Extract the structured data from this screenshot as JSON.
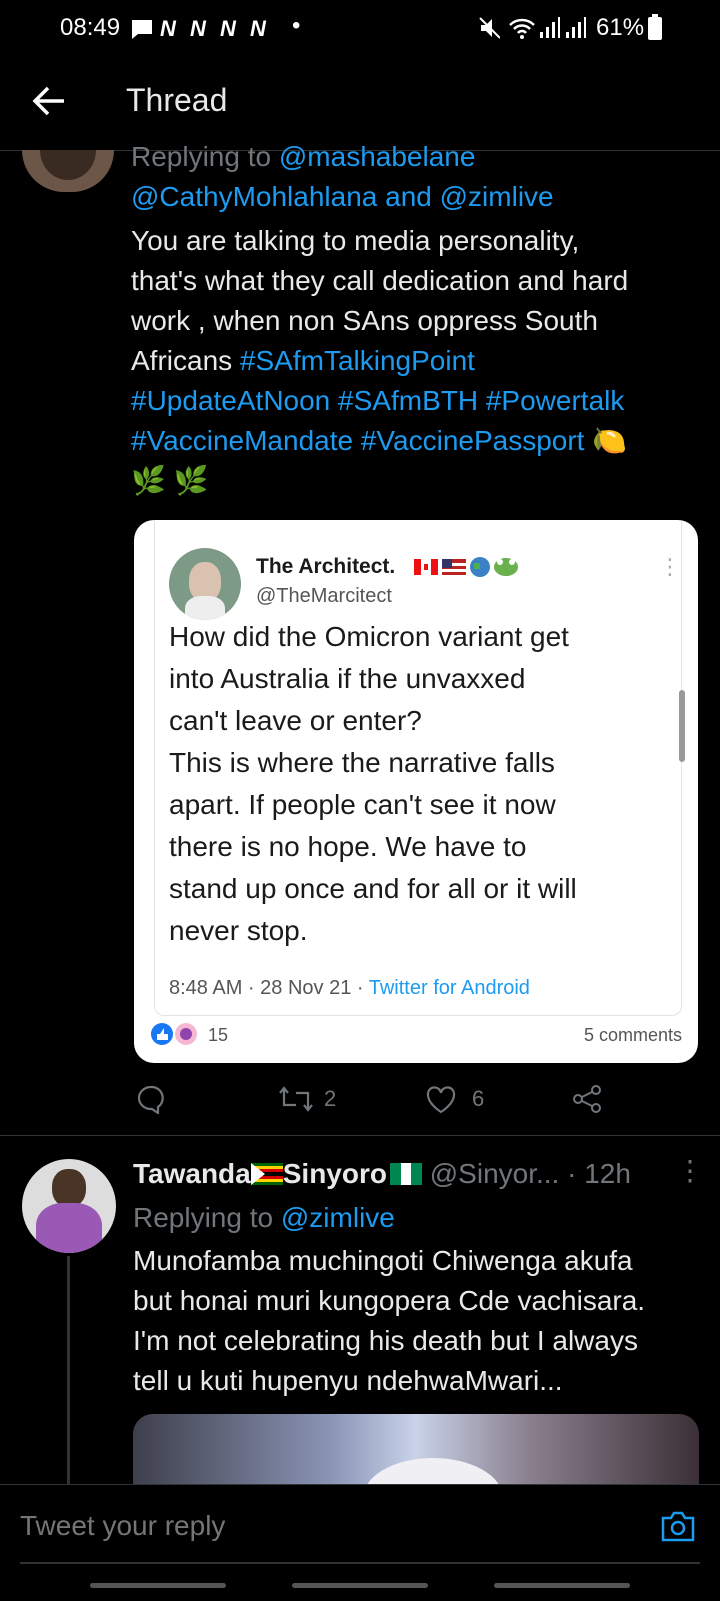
{
  "status": {
    "time": "08:49",
    "notif_letters": [
      "N",
      "N",
      "N",
      "N"
    ],
    "dot": "•",
    "battery": "61%"
  },
  "header": {
    "title": "Thread"
  },
  "tweet1": {
    "replying_prefix": "Replying to",
    "reply_handles_1": "@mashabelane",
    "reply_handles_2a": "@CathyMohlahlana",
    "reply_and": "and",
    "reply_handles_2b": "@zimlive",
    "text_lines": [
      "You are talking to media personality,",
      "that's what they call dedication and hard",
      "work , when non SAns oppress South",
      "Africans"
    ],
    "hashtags": [
      "#SAfmTalkingPoint",
      "#UpdateAtNoon",
      "#SAfmBTH",
      "#Powertalk",
      "#VaccineMandate",
      "#VaccinePassport"
    ],
    "emoji_lemon": "🍋",
    "emoji_herb": "🌿 🌿",
    "embed": {
      "name": "The Architect.",
      "handle": "@TheMarcitect",
      "text_lines": [
        "How did the Omicron variant get",
        "into Australia if the unvaxxed",
        "can't leave or enter?",
        "This is where the narrative falls",
        "apart. If people can't see it now",
        "there is no hope. We have to",
        "stand up once and for all or it will",
        "never stop."
      ],
      "time": "8:48 AM · 28 Nov 21 ·",
      "source": "Twitter for Android",
      "reactions": "15",
      "comments": "5 comments"
    },
    "retweets": "2",
    "likes": "6"
  },
  "tweet2": {
    "name_a": "Tawanda",
    "name_b": "Sinyoro",
    "handle": "@Sinyor...",
    "time": "· 12h",
    "replying_prefix": "Replying to",
    "reply_handle": "@zimlive",
    "text_lines": [
      "Munofamba muchingoti Chiwenga akufa",
      "but honai muri kungopera Cde vachisara.",
      "I'm not celebrating his death but I always",
      "tell u kuti hupenyu ndehwaMwari..."
    ]
  },
  "reply_bar": {
    "placeholder": "Tweet your reply"
  },
  "colors": {
    "accent": "#1d9bf0",
    "background": "#000000",
    "muted": "#71767b"
  }
}
